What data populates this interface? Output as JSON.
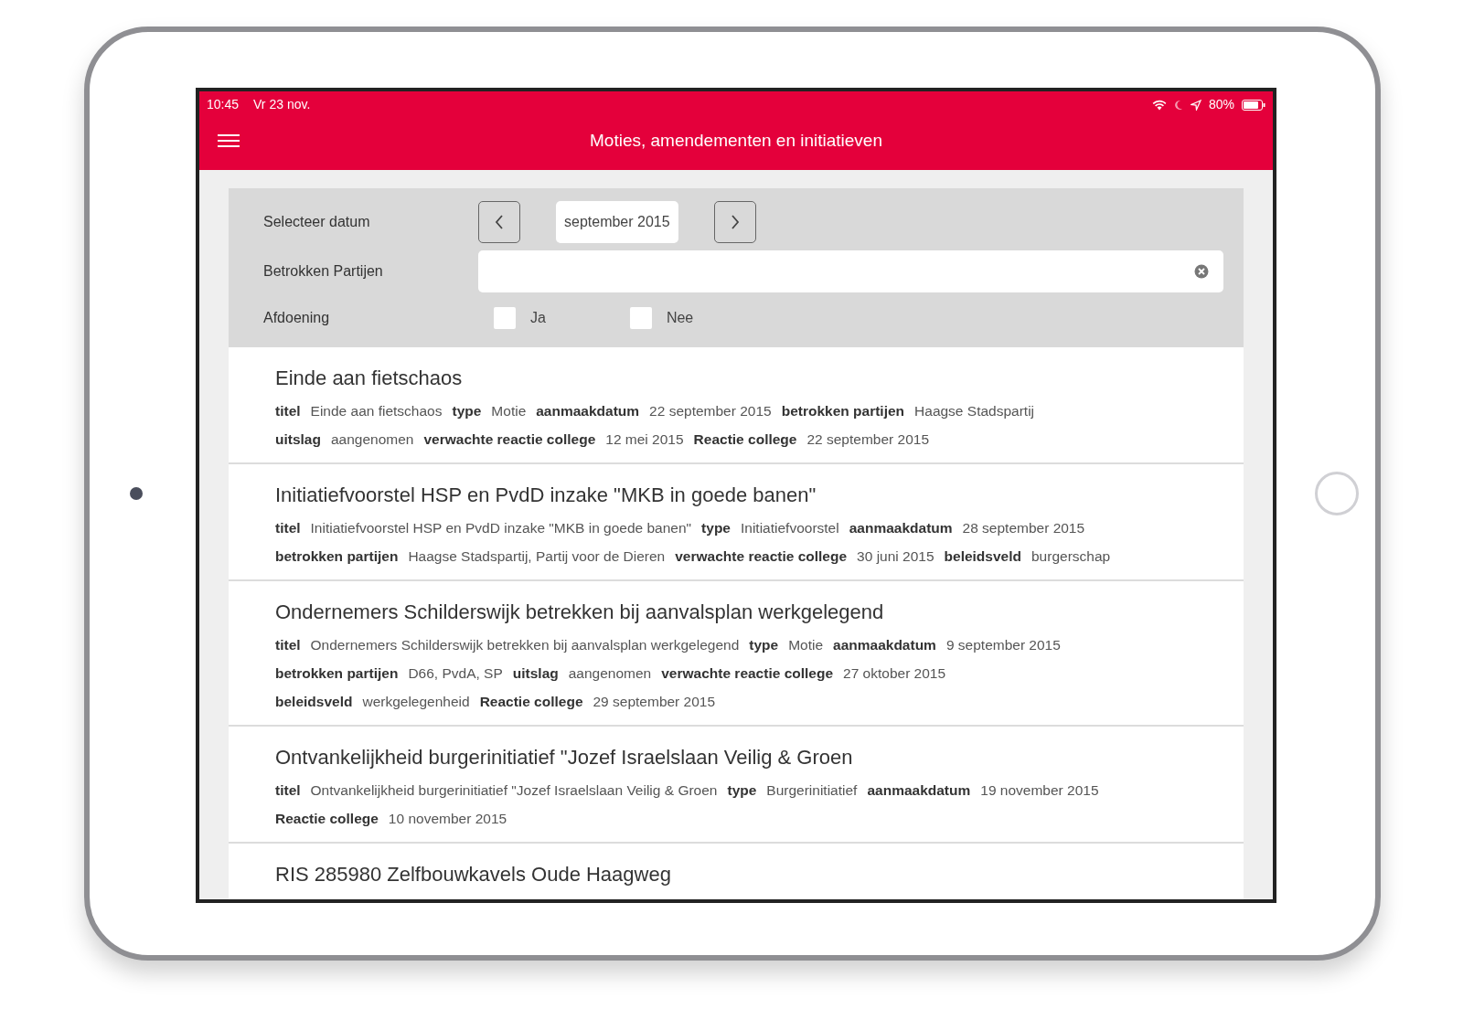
{
  "status_bar": {
    "time": "10:45",
    "date": "Vr 23 nov.",
    "battery": "80%"
  },
  "header": {
    "title": "Moties, amendementen en initiatieven"
  },
  "filters": {
    "date_label": "Selecteer datum",
    "date_value": "september 2015",
    "parties_label": "Betrokken Partijen",
    "settlement_label": "Afdoening",
    "options": [
      {
        "label": "Ja",
        "checked": false
      },
      {
        "label": "Nee",
        "checked": false
      }
    ]
  },
  "items": [
    {
      "title": "Einde aan fietschaos",
      "lines": [
        [
          {
            "label": "titel",
            "value": "Einde aan fietschaos"
          },
          {
            "label": "type",
            "value": "Motie"
          },
          {
            "label": "aanmaakdatum",
            "value": "22 september 2015"
          },
          {
            "label": "betrokken partijen",
            "value": "Haagse Stadspartij"
          }
        ],
        [
          {
            "label": "uitslag",
            "value": "aangenomen"
          },
          {
            "label": "verwachte reactie college",
            "value": "12 mei 2015"
          },
          {
            "label": "Reactie college",
            "value": "22 september 2015"
          }
        ]
      ]
    },
    {
      "title": "Initiatiefvoorstel HSP en PvdD inzake \"MKB in goede banen\"",
      "lines": [
        [
          {
            "label": "titel",
            "value": "Initiatiefvoorstel HSP en PvdD inzake \"MKB in goede banen\""
          },
          {
            "label": "type",
            "value": "Initiatiefvoorstel"
          },
          {
            "label": "aanmaakdatum",
            "value": "28 september 2015"
          }
        ],
        [
          {
            "label": "betrokken partijen",
            "value": "Haagse Stadspartij, Partij voor de Dieren"
          },
          {
            "label": "verwachte reactie college",
            "value": "30 juni 2015"
          },
          {
            "label": "beleidsveld",
            "value": "burgerschap"
          }
        ]
      ]
    },
    {
      "title": "Ondernemers Schilderswijk betrekken bij aanvalsplan werkgelegend",
      "lines": [
        [
          {
            "label": "titel",
            "value": "Ondernemers Schilderswijk betrekken bij aanvalsplan werkgelegend"
          },
          {
            "label": "type",
            "value": "Motie"
          },
          {
            "label": "aanmaakdatum",
            "value": "9 september 2015"
          }
        ],
        [
          {
            "label": "betrokken partijen",
            "value": "D66, PvdA, SP"
          },
          {
            "label": "uitslag",
            "value": "aangenomen"
          },
          {
            "label": "verwachte reactie college",
            "value": "27 oktober 2015"
          }
        ],
        [
          {
            "label": "beleidsveld",
            "value": "werkgelegenheid"
          },
          {
            "label": "Reactie college",
            "value": "29 september 2015"
          }
        ]
      ]
    },
    {
      "title": "Ontvankelijkheid burgerinitiatief \"Jozef Israelslaan Veilig & Groen",
      "lines": [
        [
          {
            "label": "titel",
            "value": "Ontvankelijkheid burgerinitiatief \"Jozef Israelslaan Veilig & Groen"
          },
          {
            "label": "type",
            "value": "Burgerinitiatief"
          },
          {
            "label": "aanmaakdatum",
            "value": "19 november 2015"
          }
        ],
        [
          {
            "label": "Reactie college",
            "value": "10 november 2015"
          }
        ]
      ]
    },
    {
      "title": "RIS 285980 Zelfbouwkavels Oude Haagweg"
    }
  ]
}
